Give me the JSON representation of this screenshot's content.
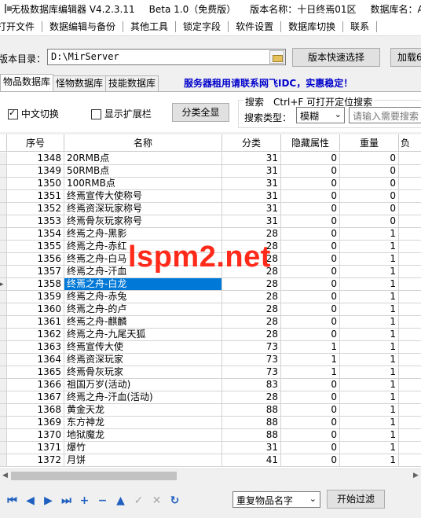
{
  "titlebar": {
    "app": "无极数据库编辑器 V4.2.3.11",
    "edition": "Beta 1.0（免费版）",
    "version": "版本名称：十日终焉01区",
    "dbname": "数据库名：A"
  },
  "menu": [
    "打开文件",
    "数据编辑与备份",
    "其他工具",
    "锁定字段",
    "软件设置",
    "数据库切换",
    "联系"
  ],
  "directory": {
    "label": "版本目录：",
    "value": "D:\\MirServer",
    "quick_button": "版本快速选择",
    "load_button": "加载6"
  },
  "tabs": [
    "物品数据库",
    "怪物数据库",
    "技能数据库"
  ],
  "ad_text": "服务器租用请联系网飞IDC，实惠稳定！",
  "options": {
    "cn_switch": "中文切换",
    "cn_checked": true,
    "ext_switch": "显示扩展栏",
    "ext_checked": false,
    "show_all": "分类全显"
  },
  "search": {
    "hint": "搜索　Ctrl+F 可打开定位搜索",
    "type_label": "搜索类型：",
    "type_value": "模糊",
    "placeholder": "请输入需要搜索"
  },
  "grid": {
    "columns": [
      "序号",
      "名称",
      "分类",
      "隐藏属性",
      "重量",
      "负"
    ],
    "selected_index": 10,
    "rows": [
      [
        "1348",
        "20RMB点",
        "31",
        "0",
        "0"
      ],
      [
        "1349",
        "50RMB点",
        "31",
        "0",
        "0"
      ],
      [
        "1350",
        "100RMB点",
        "31",
        "0",
        "0"
      ],
      [
        "1351",
        "终焉宣传大使称号",
        "31",
        "0",
        "0"
      ],
      [
        "1352",
        "终焉资深玩家称号",
        "31",
        "0",
        "0"
      ],
      [
        "1353",
        "终焉骨灰玩家称号",
        "31",
        "0",
        "0"
      ],
      [
        "1354",
        "终焉之舟-黑影",
        "28",
        "0",
        "1"
      ],
      [
        "1355",
        "终焉之舟-赤红",
        "28",
        "0",
        "1"
      ],
      [
        "1356",
        "终焉之舟-白马",
        "28",
        "0",
        "1"
      ],
      [
        "1357",
        "终焉之舟-汗血",
        "28",
        "0",
        "1"
      ],
      [
        "1358",
        "终焉之舟-白龙",
        "28",
        "0",
        "1"
      ],
      [
        "1359",
        "终焉之舟-赤兔",
        "28",
        "0",
        "1"
      ],
      [
        "1360",
        "终焉之舟-的卢",
        "28",
        "0",
        "1"
      ],
      [
        "1361",
        "终焉之舟-麒麟",
        "28",
        "0",
        "1"
      ],
      [
        "1362",
        "终焉之舟-九尾天狐",
        "28",
        "0",
        "1"
      ],
      [
        "1363",
        "终焉宣传大使",
        "73",
        "1",
        "1"
      ],
      [
        "1364",
        "终焉资深玩家",
        "73",
        "1",
        "1"
      ],
      [
        "1365",
        "终焉骨灰玩家",
        "73",
        "1",
        "1"
      ],
      [
        "1366",
        "祖国万岁(活动)",
        "83",
        "0",
        "1"
      ],
      [
        "1367",
        "终焉之舟-汗血(活动)",
        "28",
        "0",
        "1"
      ],
      [
        "1368",
        "黄金天龙",
        "88",
        "0",
        "1"
      ],
      [
        "1369",
        "东方神龙",
        "88",
        "0",
        "1"
      ],
      [
        "1370",
        "地狱魔龙",
        "88",
        "0",
        "1"
      ],
      [
        "1371",
        "爆竹",
        "31",
        "0",
        "1"
      ],
      [
        "1372",
        "月饼",
        "41",
        "0",
        "1"
      ]
    ]
  },
  "footer": {
    "dup_select": "重复物品名字",
    "filter_button": "开始过滤"
  },
  "watermark": "lspm2.net"
}
